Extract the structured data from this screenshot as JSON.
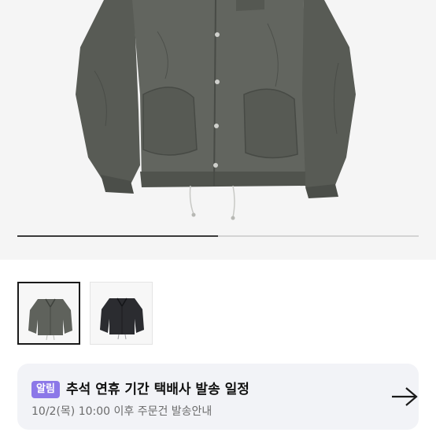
{
  "gallery": {
    "progress_fraction": 0.5,
    "thumbnails": [
      {
        "name": "olive-gray-jacket",
        "selected": true,
        "color": "#5f625c"
      },
      {
        "name": "black-jacket",
        "selected": false,
        "color": "#2b2c30"
      }
    ]
  },
  "notice": {
    "badge": "알림",
    "title": "추석 연휴 기간 택배사 발송 일정",
    "subtitle": "10/2(목) 10:00 이후 주문건 발송안내",
    "badge_color": "#8c78e8",
    "arrow_icon": "arrow-right-icon"
  },
  "colors": {
    "jacket_main": "#5f625c",
    "jacket_shadow": "#464944",
    "background": "#f5f5f5"
  }
}
